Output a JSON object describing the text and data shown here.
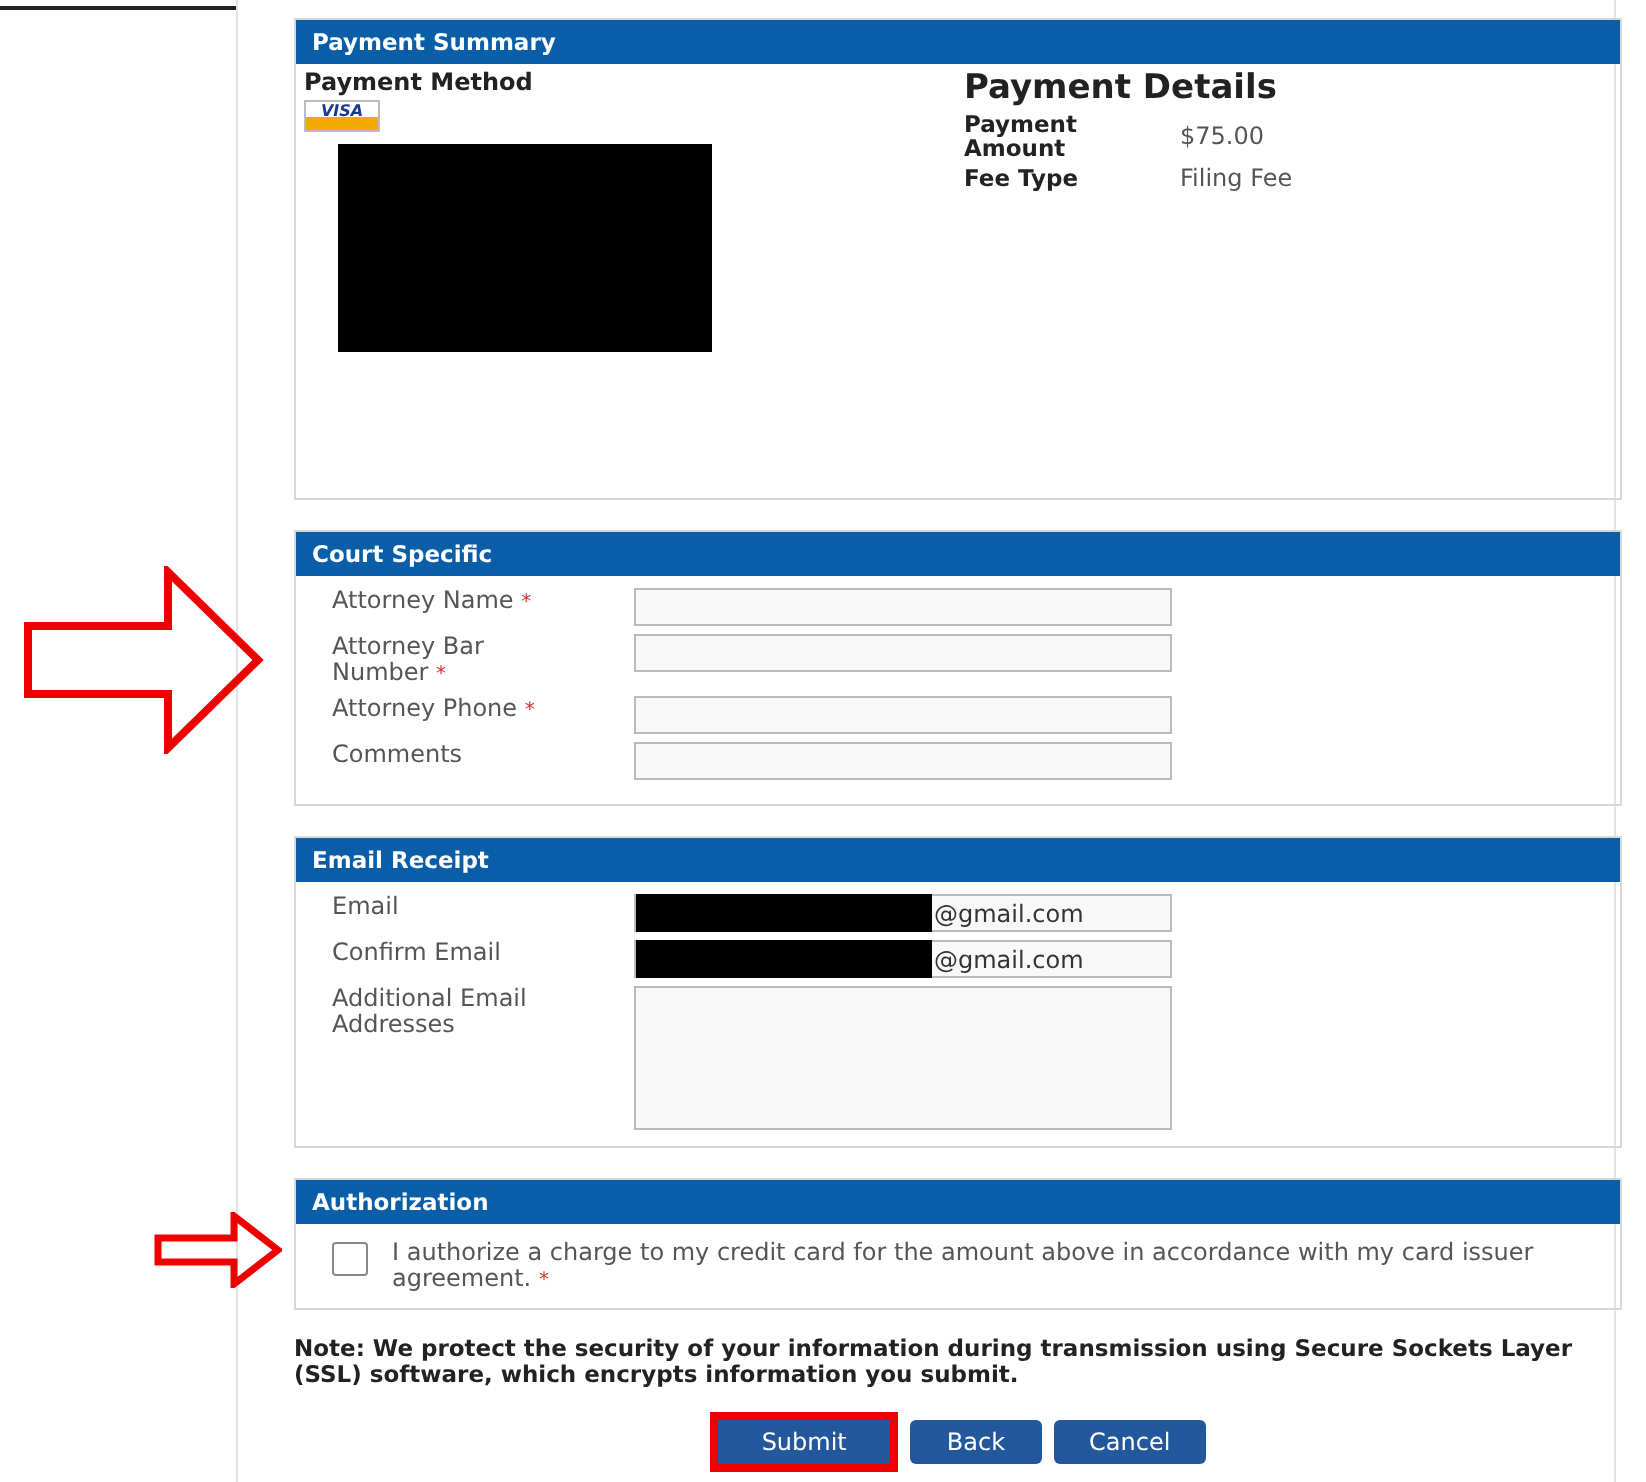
{
  "payment_summary": {
    "title": "Payment Summary",
    "method_label": "Payment Method",
    "card_brand": "VISA",
    "details_title": "Payment Details",
    "details": [
      {
        "label": "Payment Amount",
        "value": "$75.00"
      },
      {
        "label": "Fee Type",
        "value": "Filing Fee"
      }
    ]
  },
  "court_specific": {
    "title": "Court Specific",
    "fields": [
      {
        "label": "Attorney Name",
        "required_mark": "*"
      },
      {
        "label": "Attorney Bar Number",
        "required_mark": "*"
      },
      {
        "label": "Attorney Phone",
        "required_mark": "*"
      },
      {
        "label": "Comments"
      }
    ]
  },
  "email_receipt": {
    "title": "Email Receipt",
    "fields": [
      {
        "label": "Email",
        "value": "@gmail.com",
        "redacted": true,
        "kind": "input"
      },
      {
        "label": "Confirm Email",
        "value": "@gmail.com",
        "redacted": true,
        "kind": "input"
      },
      {
        "label": "Additional Email Addresses",
        "kind": "textarea"
      }
    ]
  },
  "authorization": {
    "title": "Authorization",
    "checked": false,
    "text": "I authorize a charge to my credit card for the amount above in accordance with my card issuer agreement.",
    "required_mark": "*"
  },
  "note": "Note: We protect the security of your information during transmission using Secure Sockets Layer (SSL) software, which encrypts information you submit.",
  "buttons": [
    {
      "label": "Submit",
      "highlighted": true
    },
    {
      "label": "Back",
      "highlighted": false
    },
    {
      "label": "Cancel",
      "highlighted": false
    }
  ]
}
